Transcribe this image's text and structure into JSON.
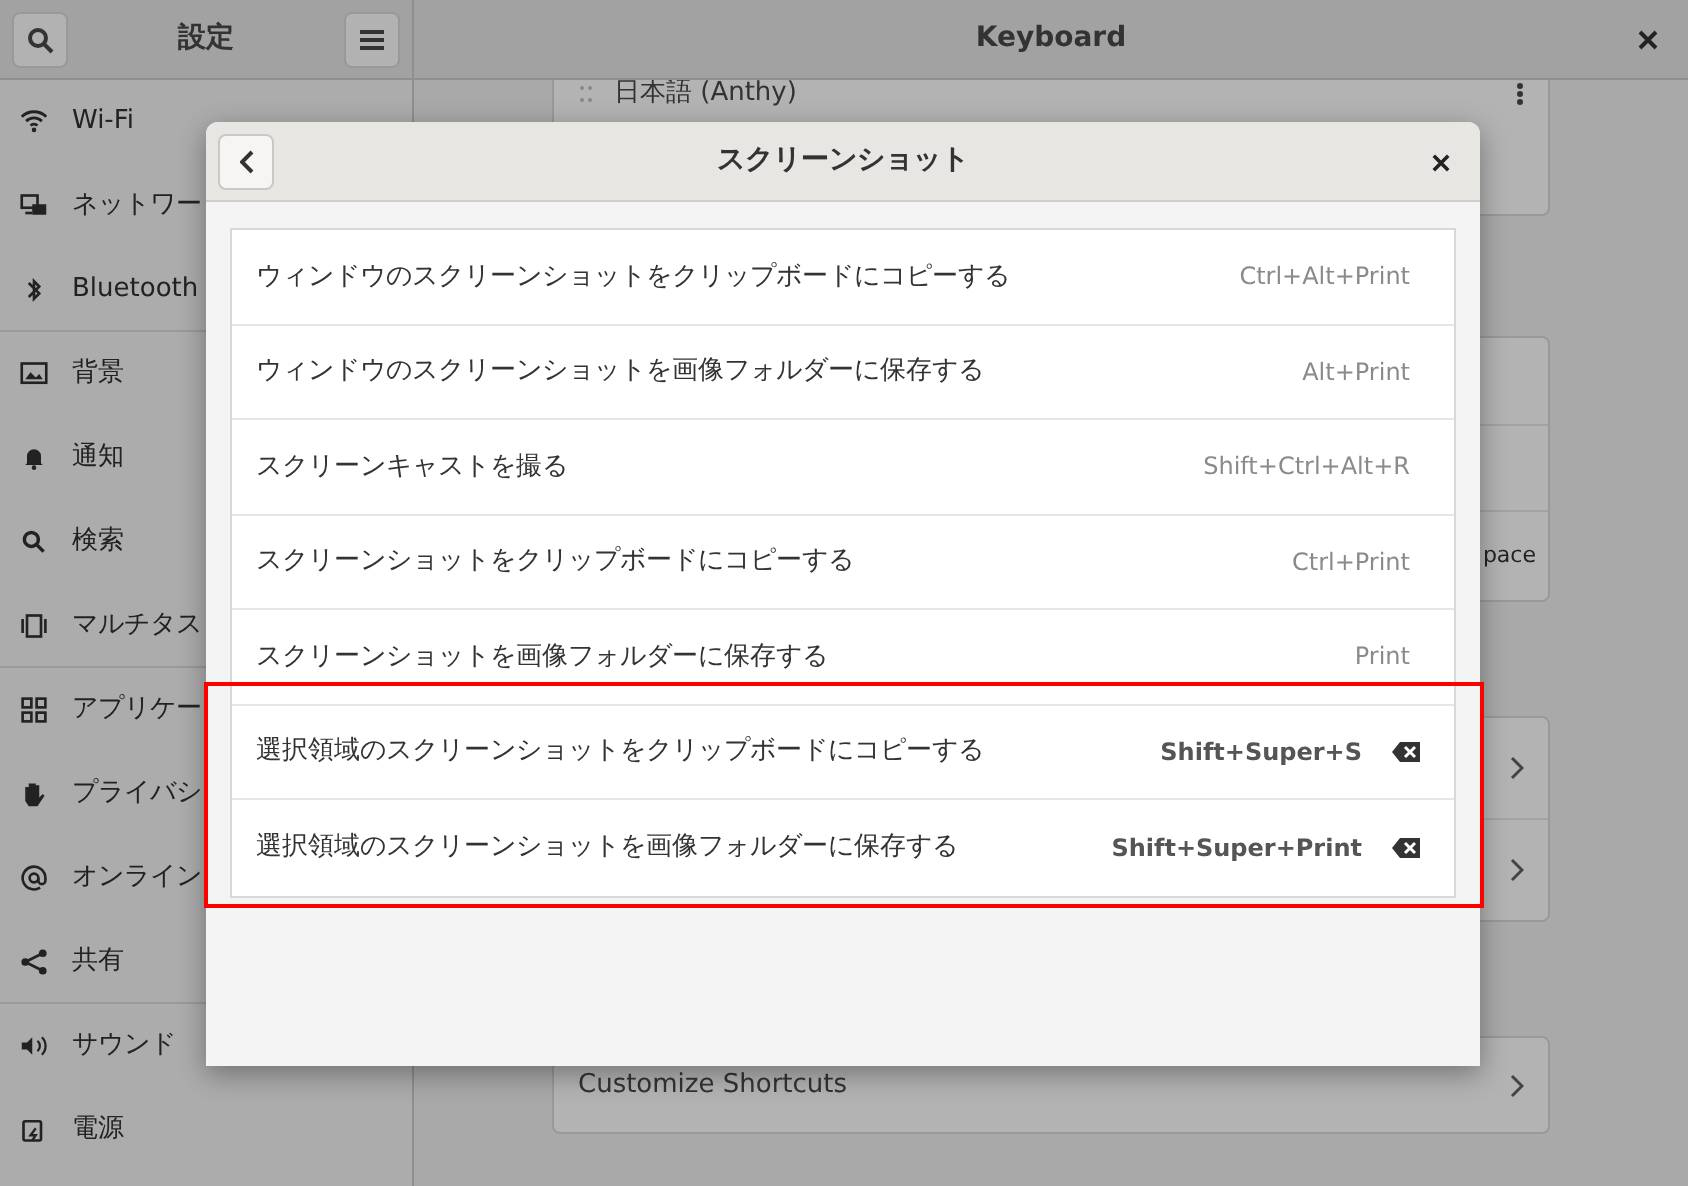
{
  "window": {
    "sidebar_title": "設定",
    "title": "Keyboard"
  },
  "sidebar": {
    "items": [
      {
        "label": "Wi-Fi",
        "divider_after": false
      },
      {
        "label": "ネットワー",
        "divider_after": false
      },
      {
        "label": "Bluetooth",
        "divider_after": true
      },
      {
        "label": "背景",
        "divider_after": false
      },
      {
        "label": "通知",
        "divider_after": false
      },
      {
        "label": "検索",
        "divider_after": false
      },
      {
        "label": "マルチタス",
        "divider_after": true
      },
      {
        "label": "アプリケー",
        "divider_after": false
      },
      {
        "label": "プライバシ",
        "divider_after": false
      },
      {
        "label": "オンライン",
        "divider_after": false
      },
      {
        "label": "共有",
        "divider_after": true
      },
      {
        "label": "サウンド",
        "divider_after": false
      },
      {
        "label": "電源",
        "divider_after": false
      }
    ]
  },
  "content": {
    "input_source": "日本語 (Anthy)",
    "partial_text": "pace",
    "customize_shortcuts": "Customize Shortcuts"
  },
  "dialog": {
    "title": "スクリーンショット",
    "shortcuts": [
      {
        "label": "ウィンドウのスクリーンショットをクリップボードにコピーする",
        "keys": "Ctrl+Alt+Print",
        "kind": "default",
        "highlighted": false
      },
      {
        "label": "ウィンドウのスクリーンショットを画像フォルダーに保存する",
        "keys": "Alt+Print",
        "kind": "default",
        "highlighted": false
      },
      {
        "label": "スクリーンキャストを撮る",
        "keys": "Shift+Ctrl+Alt+R",
        "kind": "default",
        "highlighted": false
      },
      {
        "label": "スクリーンショットをクリップボードにコピーする",
        "keys": "Ctrl+Print",
        "kind": "default",
        "highlighted": false
      },
      {
        "label": "スクリーンショットを画像フォルダーに保存する",
        "keys": "Print",
        "kind": "default",
        "highlighted": false
      },
      {
        "label": "選択領域のスクリーンショットをクリップボードにコピーする",
        "keys": "Shift+Super+S",
        "kind": "custom",
        "highlighted": true
      },
      {
        "label": "選択領域のスクリーンショットを画像フォルダーに保存する",
        "keys": "Shift+Super+Print",
        "kind": "custom",
        "highlighted": true
      }
    ]
  }
}
